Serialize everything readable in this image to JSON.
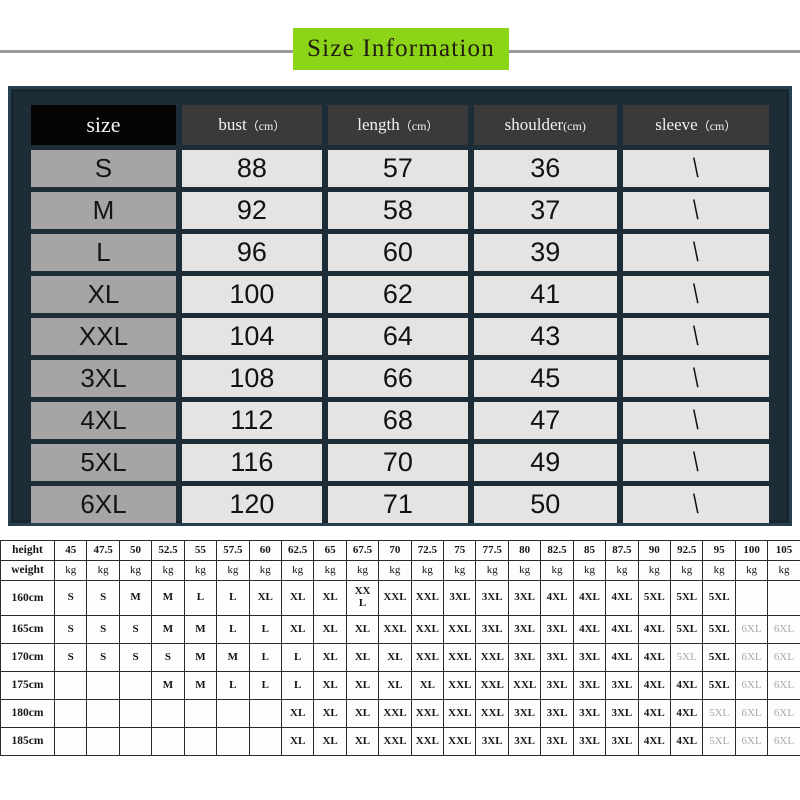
{
  "title": {
    "text": "Size Information",
    "banner_color": "#8cd418",
    "text_color": "#221d10"
  },
  "size_panel": {
    "panel_color": "#1d2d38",
    "header_bg": "#3a3a3a",
    "size_header_bg": "#050505",
    "size_cell_bg": "#a5a5a5",
    "value_cell_bg": "#e4e5e3",
    "headers": [
      {
        "label": "size",
        "unit": ""
      },
      {
        "label": "bust",
        "unit": "（cm）"
      },
      {
        "label": "length",
        "unit": "（cm）"
      },
      {
        "label": "shoulder",
        "unit": "(cm)"
      },
      {
        "label": "sleeve",
        "unit": "（cm）"
      }
    ],
    "rows": [
      {
        "size": "S",
        "bust": "88",
        "length": "57",
        "shoulder": "36",
        "sleeve": "\\"
      },
      {
        "size": "M",
        "bust": "92",
        "length": "58",
        "shoulder": "37",
        "sleeve": "\\"
      },
      {
        "size": "L",
        "bust": "96",
        "length": "60",
        "shoulder": "39",
        "sleeve": "\\"
      },
      {
        "size": "XL",
        "bust": "100",
        "length": "62",
        "shoulder": "41",
        "sleeve": "\\"
      },
      {
        "size": "XXL",
        "bust": "104",
        "length": "64",
        "shoulder": "43",
        "sleeve": "\\"
      },
      {
        "size": "3XL",
        "bust": "108",
        "length": "66",
        "shoulder": "45",
        "sleeve": "\\"
      },
      {
        "size": "4XL",
        "bust": "112",
        "length": "68",
        "shoulder": "47",
        "sleeve": "\\"
      },
      {
        "size": "5XL",
        "bust": "116",
        "length": "70",
        "shoulder": "49",
        "sleeve": "\\"
      },
      {
        "size": "6XL",
        "bust": "120",
        "length": "71",
        "shoulder": "50",
        "sleeve": "\\"
      }
    ]
  },
  "height_weight_table": {
    "corner_top": "height",
    "corner_bottom": "weight",
    "weights": [
      "45",
      "47.5",
      "50",
      "52.5",
      "55",
      "57.5",
      "60",
      "62.5",
      "65",
      "67.5",
      "70",
      "72.5",
      "75",
      "77.5",
      "80",
      "82.5",
      "85",
      "87.5",
      "90",
      "92.5",
      "95",
      "100",
      "105"
    ],
    "unit": "kg",
    "heights": [
      "160cm",
      "165cm",
      "170cm",
      "175cm",
      "180cm",
      "185cm"
    ],
    "rows": [
      {
        "height": "160cm",
        "cells": [
          "S",
          "S",
          "M",
          "M",
          "L",
          "L",
          "XL",
          "XL",
          "XL",
          "XX L",
          "XXL",
          "XXL",
          "3XL",
          "3XL",
          "3XL",
          "4XL",
          "4XL",
          "4XL",
          "5XL",
          "5XL",
          "5XL",
          "",
          ""
        ],
        "faded": []
      },
      {
        "height": "165cm",
        "cells": [
          "S",
          "S",
          "S",
          "M",
          "M",
          "L",
          "L",
          "XL",
          "XL",
          "XL",
          "XXL",
          "XXL",
          "XXL",
          "3XL",
          "3XL",
          "3XL",
          "4XL",
          "4XL",
          "4XL",
          "5XL",
          "5XL",
          "6XL",
          "6XL"
        ],
        "faded": [
          21,
          22
        ]
      },
      {
        "height": "170cm",
        "cells": [
          "S",
          "S",
          "S",
          "S",
          "M",
          "M",
          "L",
          "L",
          "XL",
          "XL",
          "XL",
          "XXL",
          "XXL",
          "XXL",
          "3XL",
          "3XL",
          "3XL",
          "4XL",
          "4XL",
          "5XL",
          "5XL",
          "6XL",
          "6XL"
        ],
        "faded": [
          19,
          21,
          22
        ]
      },
      {
        "height": "175cm",
        "cells": [
          "",
          "",
          "",
          "M",
          "M",
          "L",
          "L",
          "L",
          "XL",
          "XL",
          "XL",
          "XL",
          "XXL",
          "XXL",
          "XXL",
          "3XL",
          "3XL",
          "3XL",
          "4XL",
          "4XL",
          "5XL",
          "6XL",
          "6XL"
        ],
        "faded": [
          21,
          22
        ]
      },
      {
        "height": "180cm",
        "cells": [
          "",
          "",
          "",
          "",
          "",
          "",
          "",
          "XL",
          "XL",
          "XL",
          "XXL",
          "XXL",
          "XXL",
          "XXL",
          "3XL",
          "3XL",
          "3XL",
          "3XL",
          "4XL",
          "4XL",
          "5XL",
          "6XL",
          "6XL"
        ],
        "faded": [
          20,
          21,
          22
        ]
      },
      {
        "height": "185cm",
        "cells": [
          "",
          "",
          "",
          "",
          "",
          "",
          "",
          "XL",
          "XL",
          "XL",
          "XXL",
          "XXL",
          "XXL",
          "3XL",
          "3XL",
          "3XL",
          "3XL",
          "3XL",
          "4XL",
          "4XL",
          "5XL",
          "6XL",
          "6XL"
        ],
        "faded": [
          20,
          21,
          22
        ]
      }
    ]
  }
}
